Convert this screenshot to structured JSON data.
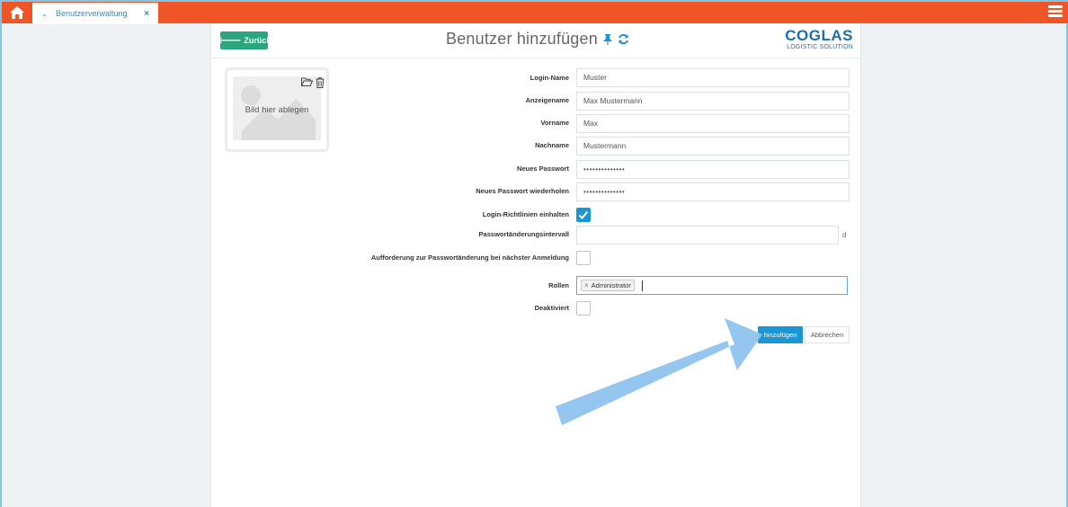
{
  "topbar": {
    "tab_label": "Benutzerverwaltung",
    "tab_close": "×",
    "tab_chevron": "⌄"
  },
  "header": {
    "back_label": "Zurück",
    "title": "Benutzer hinzufügen",
    "logo_brand": "COGLAS",
    "logo_tagline": "LOGISTIC SOLUTION"
  },
  "image_drop": {
    "label": "Bild hier ablegen"
  },
  "form": {
    "login_name": {
      "label": "Login-Name",
      "value": "Muster"
    },
    "display_name": {
      "label": "Anzeigename",
      "value": "Max Mustermann"
    },
    "first_name": {
      "label": "Vorname",
      "value": "Max"
    },
    "last_name": {
      "label": "Nachname",
      "value": "Mustermann"
    },
    "new_password": {
      "label": "Neues Passwort",
      "value": "••••••••••••••"
    },
    "new_password_repeat": {
      "label": "Neues Passwort wiederholen",
      "value": "••••••••••••••"
    },
    "login_policy": {
      "label": "Login-Richtlinien einhalten",
      "checked": true
    },
    "password_interval": {
      "label": "Passwortänderungsintervall",
      "value": "",
      "unit": "d"
    },
    "force_change": {
      "label": "Aufforderung zur Passwortänderung bei nächster Anmeldung",
      "checked": false
    },
    "roles": {
      "label": "Rollen",
      "tags": [
        "Administrator"
      ],
      "tag_remove": "×"
    },
    "disabled": {
      "label": "Deaktiviert",
      "checked": false
    }
  },
  "actions": {
    "submit_label": "hinzufügen",
    "cancel_label": "Abbrechen"
  },
  "colors": {
    "topbar": "#ef5526",
    "back_button": "#2aa57e",
    "primary": "#1a96d4",
    "brand": "#1e6fa8",
    "annotation_arrow": "#8fc3ee"
  }
}
